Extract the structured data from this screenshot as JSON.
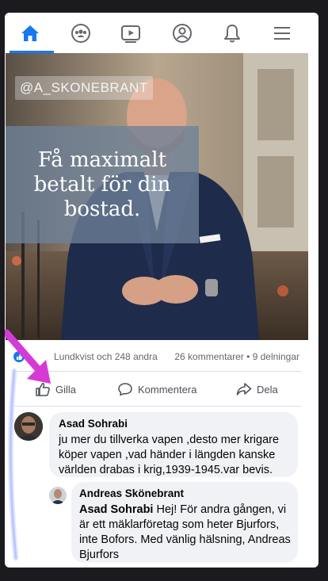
{
  "nav": {
    "items": [
      "home-icon",
      "groups-icon",
      "watch-icon",
      "profile-icon",
      "notifications-icon",
      "menu-icon"
    ],
    "accent": "#1877f2"
  },
  "post": {
    "handle": "@A_SKONEBRANT",
    "promo_text": "Få maximalt betalt för din bostad.",
    "likes_text": "Lundkvist och 248 andra",
    "counts_text": "26 kommentarer • 9 delningar"
  },
  "actions": {
    "like": "Gilla",
    "comment": "Kommentera",
    "share": "Dela"
  },
  "comments": [
    {
      "author": "Asad Sohrabi",
      "text": "ju mer du tillverka vapen ,desto mer krigare köper vapen ,vad händer i längden kanske världen drabas i krig,1939-1945.var bevis."
    },
    {
      "author": "Andreas Skönebrant",
      "mention": "Asad Sohrabi",
      "text": " Hej! För andra gången, vi är ett mäklarföretag som heter Bjurfors, inte Bofors. Med vänlig hälsning, Andreas Bjurfors"
    }
  ]
}
